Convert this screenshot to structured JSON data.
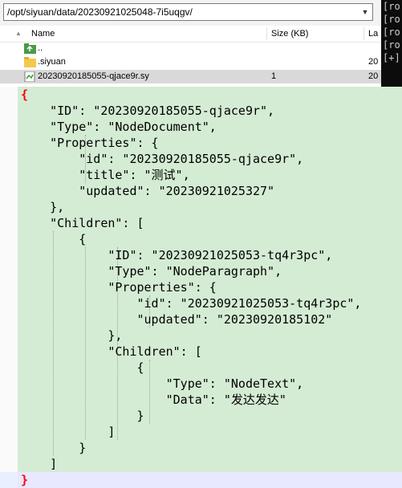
{
  "path_bar": {
    "path": "/opt/siyuan/data/20230921025048-7i5uqgv/"
  },
  "terminal": {
    "lines": [
      "[ro",
      "[ro",
      "[ro",
      "[ro",
      "[+]"
    ]
  },
  "file_list": {
    "headers": {
      "name": "Name",
      "size": "Size (KB)",
      "date": "La"
    },
    "rows": [
      {
        "name": "..",
        "size": "",
        "date": "",
        "icon": "parent-folder-icon"
      },
      {
        "name": ".siyuan",
        "size": "",
        "date": "20",
        "icon": "folder-icon"
      },
      {
        "name": "20230920185055-qjace9r.sy",
        "size": "1",
        "date": "20",
        "icon": "file-icon",
        "selected": true
      }
    ]
  },
  "editor": {
    "lines": [
      "{",
      "    \"ID\": \"20230920185055-qjace9r\",",
      "    \"Type\": \"NodeDocument\",",
      "    \"Properties\": {",
      "        \"id\": \"20230920185055-qjace9r\",",
      "        \"title\": \"测试\",",
      "        \"updated\": \"20230921025327\"",
      "    },",
      "    \"Children\": [",
      "        {",
      "            \"ID\": \"20230921025053-tq4r3pc\",",
      "            \"Type\": \"NodeParagraph\",",
      "            \"Properties\": {",
      "                \"id\": \"20230921025053-tq4r3pc\",",
      "                \"updated\": \"20230920185102\"",
      "            },",
      "            \"Children\": [",
      "                {",
      "                    \"Type\": \"NodeText\",",
      "                    \"Data\": \"发达发达\"",
      "                }",
      "            ]",
      "        }",
      "    ]",
      "}"
    ]
  },
  "colors": {
    "editor_bg": "#d4ecd4",
    "brace": "#ff0000",
    "path_bar_bg": "#f3f3f3"
  }
}
